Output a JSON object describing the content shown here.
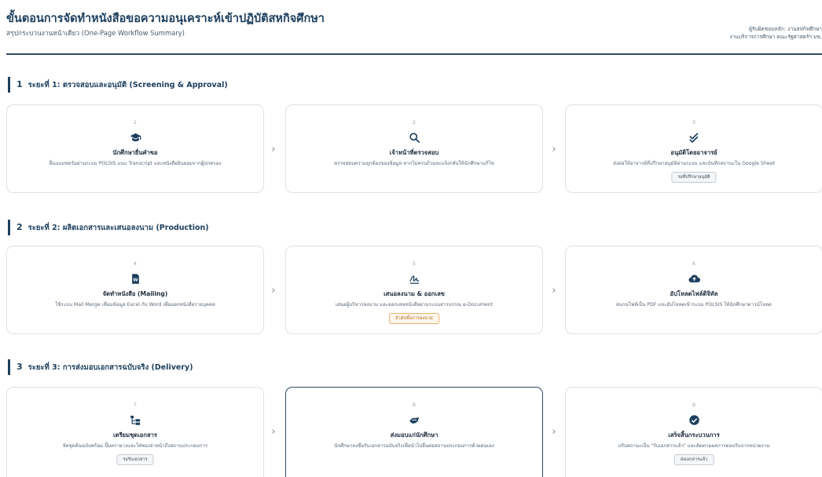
{
  "header": {
    "title": "ขั้นตอนการจัดทำหนังสือขอความอนุเคราะห์เข้าปฏิบัติสหกิจศึกษา",
    "subtitle": "สรุปกระบวนงานหน้าเดียว (One-Page Workflow Summary)",
    "right_line1": "ผู้รับผิดชอบหลัก: งานสหกิจศึกษา",
    "right_line2": "งานบริการการศึกษา คณะรัฐศาสตร์ฯ มข."
  },
  "phases": [
    {
      "num": "1",
      "label": "ระยะที่ 1: ตรวจสอบและอนุมัติ (Screening & Approval)",
      "steps": [
        {
          "num": "1",
          "icon": "graduation-cap-icon",
          "title": "นักศึกษายื่นคำขอ",
          "desc": "ยื่นแบบฟอร์มผ่านระบบ POLSIS แนบ Transcript และหนังสือยินยอมจากผู้ปกครอง",
          "badge": ""
        },
        {
          "num": "2",
          "icon": "search-icon",
          "title": "เจ้าหน้าที่ตรวจสอบ",
          "desc": "ตรวจสอบความถูกต้องของข้อมูล หากไม่ครบถ้วนจะแจ้งกลับให้นักศึกษาแก้ไข",
          "badge": ""
        },
        {
          "num": "3",
          "icon": "double-check-icon",
          "title": "อนุมัติโดยอาจารย์",
          "desc": "ส่งต่อให้อาจารย์ที่ปรึกษาอนุมัติผ่านระบบ และบันทึกสถานะใน Google Sheet",
          "badge": "รอที่ปรึกษาอนุมัติ"
        }
      ]
    },
    {
      "num": "2",
      "label": "ระยะที่ 2: ผลิตเอกสารและเสนอลงนาม (Production)",
      "steps": [
        {
          "num": "4",
          "icon": "word-document-icon",
          "title": "จัดทำหนังสือ (Mailing)",
          "desc": "ใช้ระบบ Mail Merge เชื่อมข้อมูล Excel กับ Word เพื่อออกหนังสือรายบุคคล",
          "badge": ""
        },
        {
          "num": "5",
          "icon": "signature-icon",
          "title": "เสนอลงนาม & ออกเลข",
          "desc": "เสนอผู้บริหารลงนาม และออกเลขหนังสือผ่านระบบสารบรรณ e-Document",
          "badge": "ลำดับขั้นการลงนาม"
        },
        {
          "num": "6",
          "icon": "cloud-upload-icon",
          "title": "อัปโหลดไฟล์ดิจิทัล",
          "desc": "สแกนไฟล์เป็น PDF และอัปโหลดเข้าระบบ POLSIS ให้นักศึกษาดาวน์โหลด",
          "badge": ""
        }
      ]
    },
    {
      "num": "3",
      "label": "ระยะที่ 3: การส่งมอบเอกสารฉบับจริง (Delivery)",
      "steps": [
        {
          "num": "7",
          "icon": "folder-tree-icon",
          "title": "เตรียมชุดเอกสาร",
          "desc": "จัดชุดต้นฉบับพร้อม ปั๊มตรายางและใส่ซองจ่าหน้าถึงสถานประกอบการ",
          "badge": "รอรับเอกสาร"
        },
        {
          "num": "8",
          "icon": "handshake-icon",
          "title": "ส่งมอบแก่นักศึกษา",
          "desc": "นักศึกษาลงชื่อรับเอกสารฉบับจริงเพื่อนำไปยื่นต่อสถานประกอบการด้วยตนเอง",
          "badge": ""
        },
        {
          "num": "9",
          "icon": "check-circle-icon",
          "title": "เสร็จสิ้นกระบวนการ",
          "desc": "ปรับสถานะเป็น \"รับเอกสารแล้ว\" และติดตามผลการตอบรับจากหน่วยงาน",
          "badge": "ส่งเอกสารแล้ว"
        }
      ]
    }
  ],
  "colors": {
    "primary": "#1c3f5e",
    "accent_orange": "#b86a1c",
    "border": "#dde2e8"
  }
}
